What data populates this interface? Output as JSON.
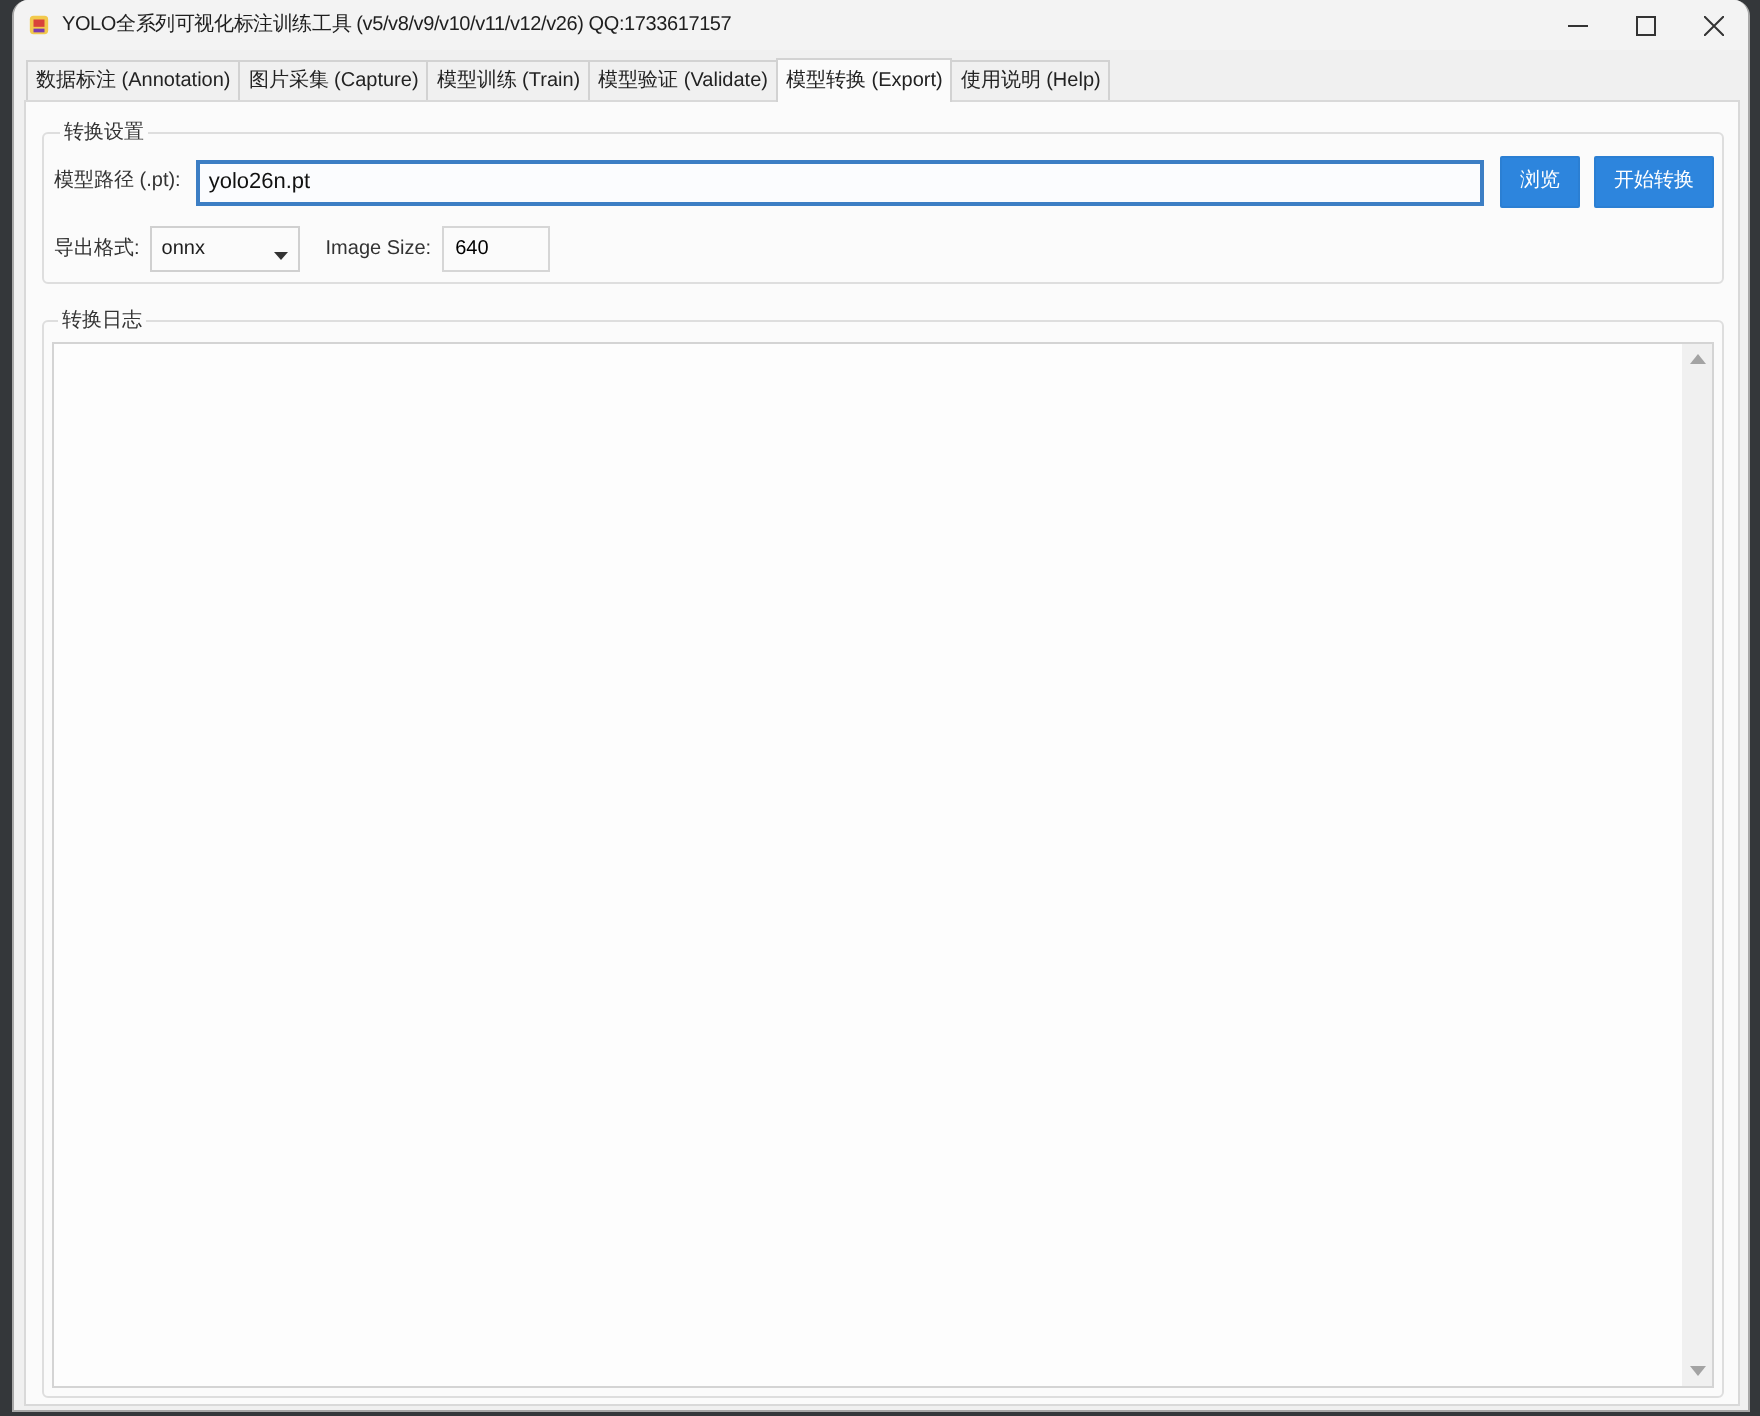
{
  "window": {
    "title": "YOLO全系列可视化标注训练工具 (v5/v8/v9/v10/v11/v12/v26) QQ:1733617157"
  },
  "tabs": [
    {
      "label": "数据标注 (Annotation)",
      "selected": false
    },
    {
      "label": "图片采集 (Capture)",
      "selected": false
    },
    {
      "label": "模型训练 (Train)",
      "selected": false
    },
    {
      "label": "模型验证 (Validate)",
      "selected": false
    },
    {
      "label": "模型转换 (Export)",
      "selected": true
    },
    {
      "label": "使用说明 (Help)",
      "selected": false
    }
  ],
  "export_settings": {
    "title": "转换设置",
    "model_path": {
      "label": "模型路径 (.pt):",
      "value": "yolo26n.pt",
      "focused": true
    },
    "buttons": [
      "浏览",
      "开始转换"
    ],
    "export_format": {
      "label": "导出格式:",
      "value": "onnx"
    },
    "image_size": {
      "label": "Image Size:",
      "value": "640"
    }
  },
  "conversion_log": {
    "title": "转换日志"
  }
}
